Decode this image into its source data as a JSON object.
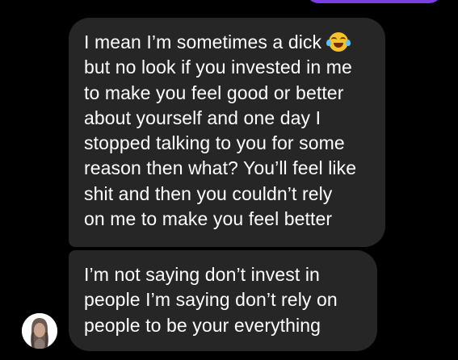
{
  "thread": {
    "messages": [
      {
        "lines": [
          "I mean I’m sometimes a dick",
          "but no look if you invested in me",
          "to make you feel good or better",
          "about yourself and one day I",
          "stopped talking to you for some",
          "reason then what? You’ll feel like",
          "shit and then you couldn’t rely",
          "on me to make you feel better"
        ],
        "emoji": "face-with-tears-of-joy-icon"
      },
      {
        "lines": [
          "I’m not saying don’t invest in",
          "people I’m saying don’t rely on",
          "people to be your everything"
        ]
      }
    ]
  },
  "colors": {
    "background": "#000000",
    "bubble": "#262626",
    "text": "#ffffff",
    "sent_bubble_accent": "#7a3fe0"
  }
}
